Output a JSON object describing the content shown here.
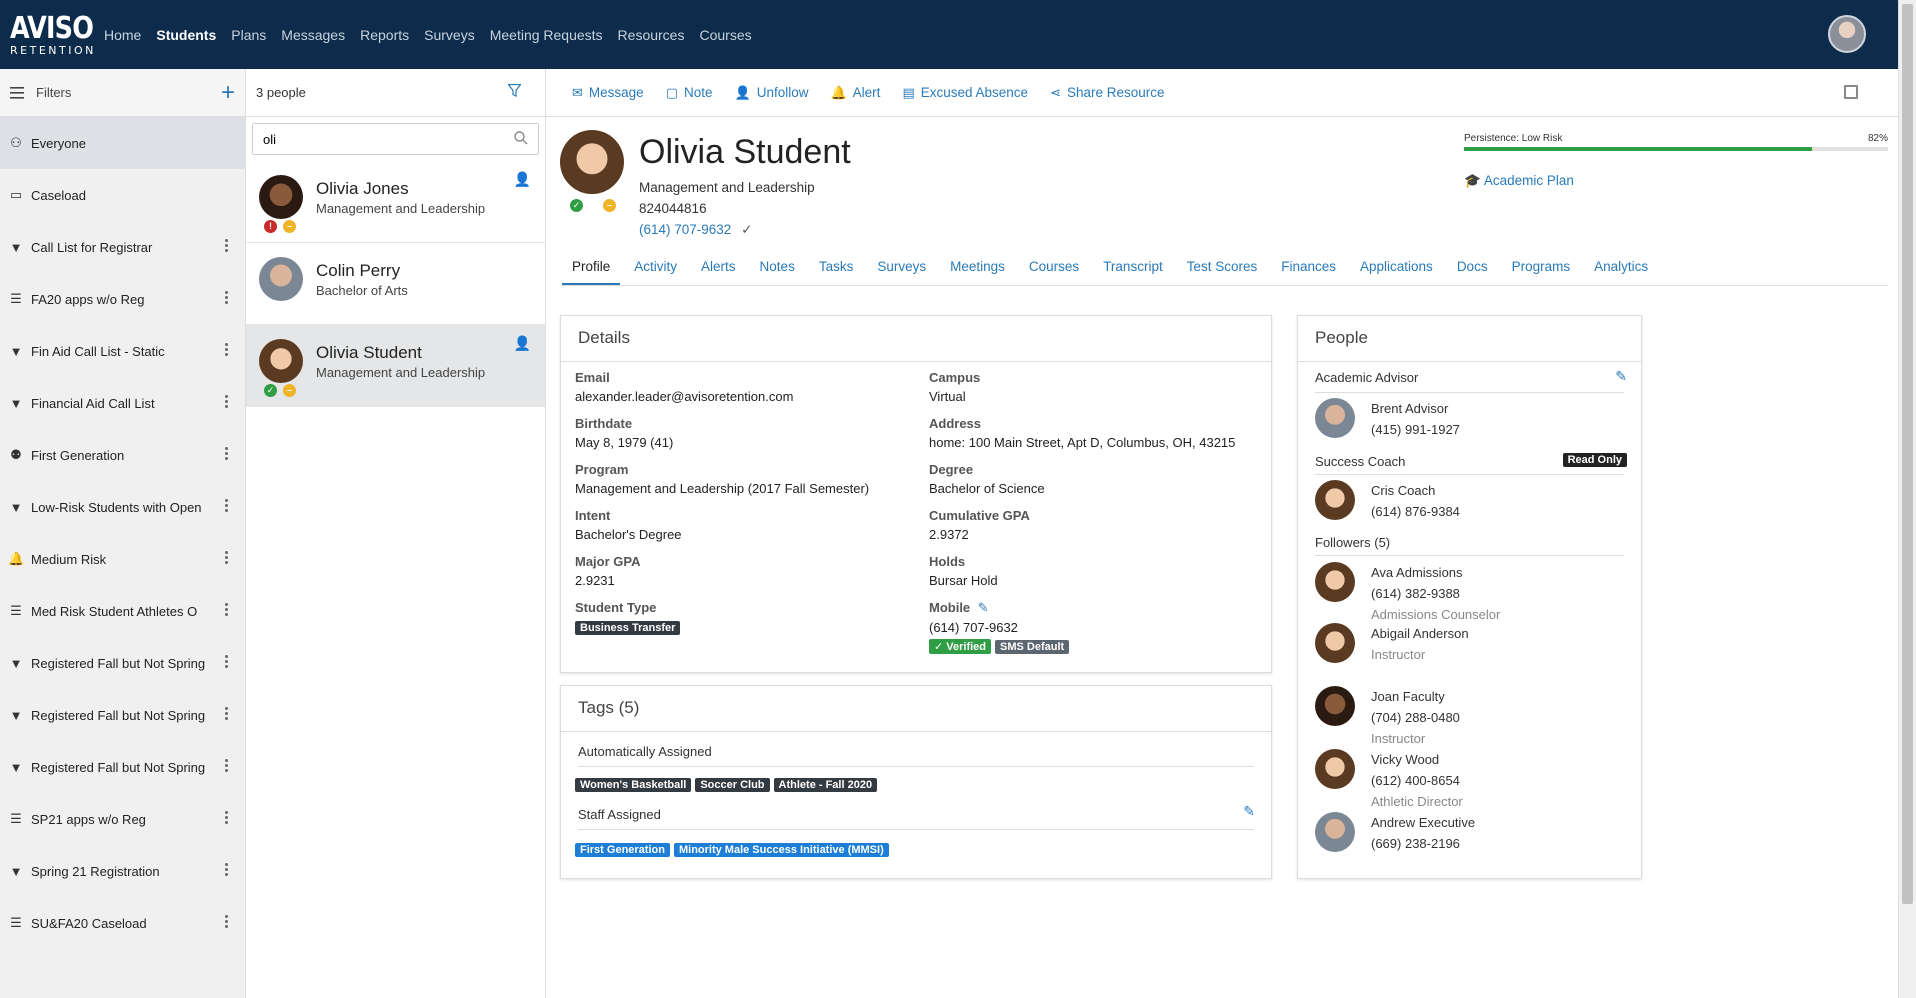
{
  "nav": {
    "logo_top": "AVISO",
    "logo_bottom": "RETENTION",
    "items": [
      "Home",
      "Students",
      "Plans",
      "Messages",
      "Reports",
      "Surveys",
      "Meeting Requests",
      "Resources",
      "Courses"
    ],
    "active": "Students"
  },
  "filters": {
    "title": "Filters",
    "items": [
      {
        "label": "Everyone",
        "icon": "group-icon",
        "menu": false,
        "active": true
      },
      {
        "label": "Caseload",
        "icon": "briefcase-icon",
        "menu": false
      },
      {
        "label": "Call List for Registrar",
        "icon": "filter-icon",
        "menu": true
      },
      {
        "label": "FA20 apps w/o Reg",
        "icon": "list-icon",
        "menu": true
      },
      {
        "label": "Fin Aid Call List - Static",
        "icon": "filter-icon",
        "menu": true
      },
      {
        "label": "Financial Aid Call List",
        "icon": "filter-icon",
        "menu": true
      },
      {
        "label": "First Generation",
        "icon": "users-icon",
        "menu": true
      },
      {
        "label": "Low-Risk Students with Open",
        "icon": "filter-icon",
        "menu": true
      },
      {
        "label": "Medium Risk",
        "icon": "bell-icon",
        "menu": true
      },
      {
        "label": "Med Risk Student Athletes O",
        "icon": "list-icon",
        "menu": true
      },
      {
        "label": "Registered Fall but Not Spring",
        "icon": "filter-icon",
        "menu": true
      },
      {
        "label": "Registered Fall but Not Spring",
        "icon": "filter-icon",
        "menu": true
      },
      {
        "label": "Registered Fall but Not Spring",
        "icon": "filter-icon",
        "menu": true
      },
      {
        "label": "SP21 apps w/o Reg",
        "icon": "list-icon",
        "menu": true
      },
      {
        "label": "Spring 21 Registration",
        "icon": "filter-icon",
        "menu": true
      },
      {
        "label": "SU&FA20 Caseload",
        "icon": "list-icon",
        "menu": true
      }
    ]
  },
  "people": {
    "count": "3 people",
    "search_value": "oli",
    "list": [
      {
        "name": "Olivia Jones",
        "program": "Management and Leadership",
        "badges": [
          "red",
          "yel"
        ],
        "follow": true,
        "face": "face-dark",
        "selected": false
      },
      {
        "name": "Colin Perry",
        "program": "Bachelor of Arts",
        "badges": [],
        "follow": false,
        "face": "face-male",
        "selected": false
      },
      {
        "name": "Olivia Student",
        "program": "Management and Leadership",
        "badges": [
          "grn",
          "yel"
        ],
        "follow": true,
        "face": "face-fem",
        "selected": true
      }
    ]
  },
  "toolbar": {
    "message": "Message",
    "note": "Note",
    "unfollow": "Unfollow",
    "alert": "Alert",
    "excused": "Excused Absence",
    "share": "Share Resource"
  },
  "profile": {
    "name": "Olivia Student",
    "program": "Management and Leadership",
    "id": "824044816",
    "phone": "(614) 707-9632",
    "persistence_label": "Persistence: Low Risk",
    "persistence_pct": "82%",
    "persistence_value": 0.82,
    "academic_plan": "Academic Plan"
  },
  "tabs": [
    "Profile",
    "Activity",
    "Alerts",
    "Notes",
    "Tasks",
    "Surveys",
    "Meetings",
    "Courses",
    "Transcript",
    "Test Scores",
    "Finances",
    "Applications",
    "Docs",
    "Programs",
    "Analytics"
  ],
  "details": {
    "title": "Details",
    "email_k": "Email",
    "email_v": "alexander.leader@avisoretention.com",
    "campus_k": "Campus",
    "campus_v": "Virtual",
    "birth_k": "Birthdate",
    "birth_v": "May 8, 1979 (41)",
    "address_k": "Address",
    "address_v": "home: 100 Main Street, Apt D, Columbus, OH, 43215",
    "program_k": "Program",
    "program_v": "Management and Leadership (2017 Fall Semester)",
    "degree_k": "Degree",
    "degree_v": "Bachelor of Science",
    "intent_k": "Intent",
    "intent_v": "Bachelor's Degree",
    "cgpa_k": "Cumulative GPA",
    "cgpa_v": "2.9372",
    "mgpa_k": "Major GPA",
    "mgpa_v": "2.9231",
    "holds_k": "Holds",
    "holds_v": "Bursar Hold",
    "stype_k": "Student Type",
    "stype_tag": "Business Transfer",
    "mobile_k": "Mobile",
    "mobile_v": "(614) 707-9632",
    "verified": "✓ Verified",
    "sms_default": "SMS Default"
  },
  "tags": {
    "title": "Tags (5)",
    "auto_h": "Automatically Assigned",
    "auto": [
      "Women's Basketball",
      "Soccer Club",
      "Athlete - Fall 2020"
    ],
    "staff_h": "Staff Assigned",
    "staff": [
      "First Generation",
      "Minority Male Success Initiative (MMSI)"
    ]
  },
  "people_panel": {
    "title": "People",
    "advisor_h": "Academic Advisor",
    "advisor": {
      "name": "Brent Advisor",
      "phone": "(415) 991-1927"
    },
    "coach_h": "Success Coach",
    "read_only": "Read Only",
    "coach": {
      "name": "Cris Coach",
      "phone": "(614) 876-9384"
    },
    "followers_h": "Followers (5)",
    "followers": [
      {
        "name": "Ava Admissions",
        "phone": "(614) 382-9388",
        "role": "Admissions Counselor"
      },
      {
        "name": "Abigail Anderson",
        "phone": "",
        "role": "Instructor"
      },
      {
        "name": "Joan Faculty",
        "phone": "(704) 288-0480",
        "role": "Instructor"
      },
      {
        "name": "Vicky Wood",
        "phone": "(612) 400-8654",
        "role": "Athletic Director"
      },
      {
        "name": "Andrew Executive",
        "phone": "(669) 238-2196",
        "role": ""
      }
    ]
  }
}
